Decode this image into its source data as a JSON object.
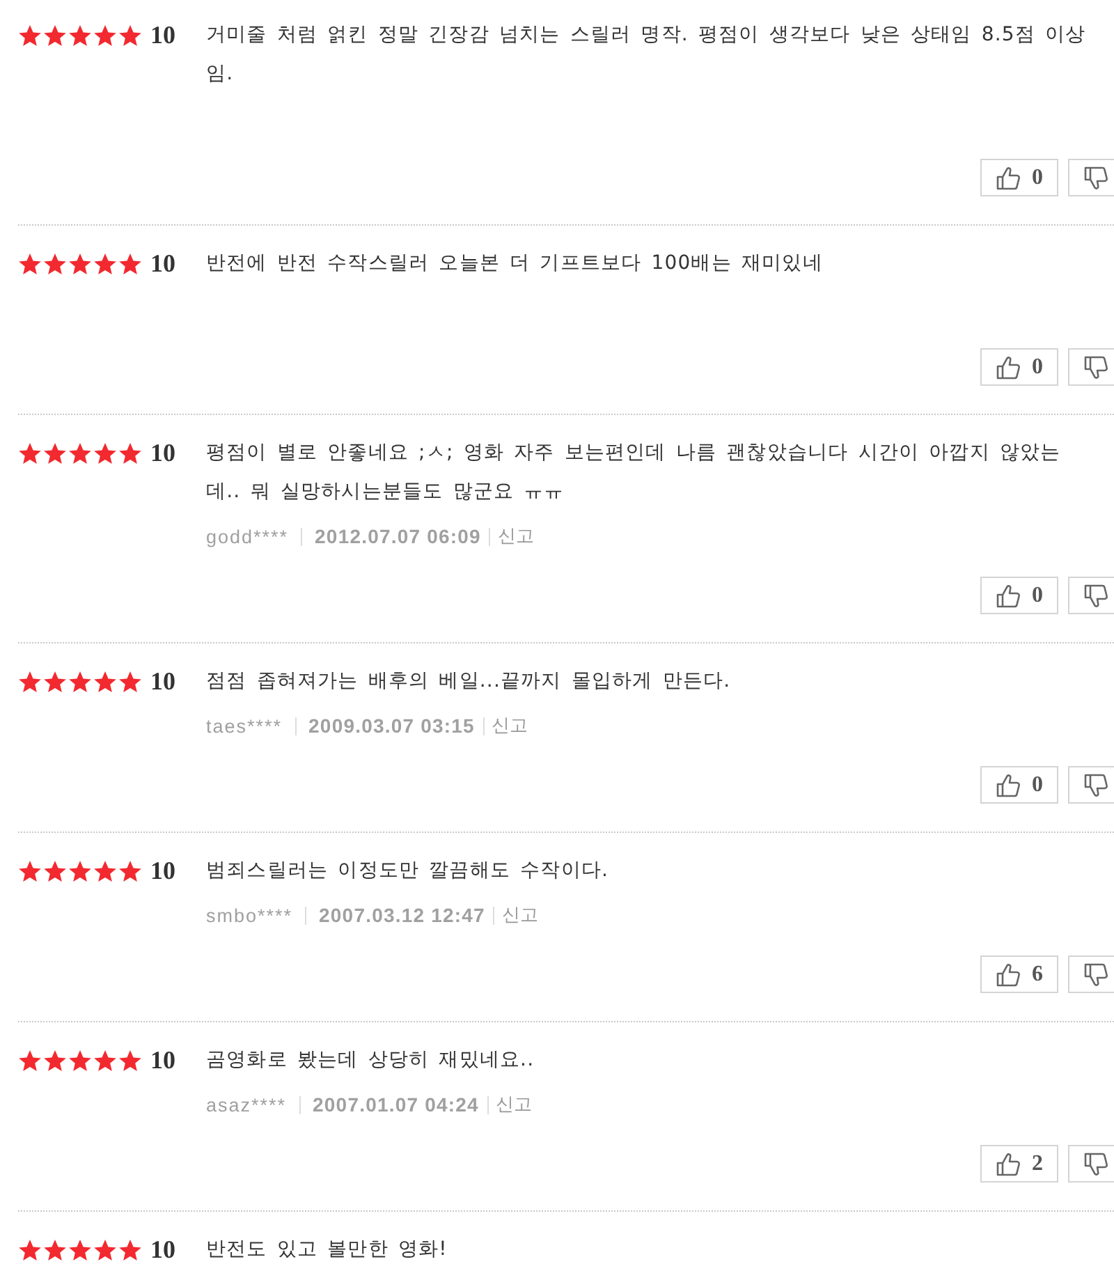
{
  "reviews": [
    {
      "stars": 5,
      "score": "10",
      "text": "거미줄 처럼 얽킨 정말 긴장감 넘치는 스릴러 명작. 평점이 생각보다 낮은 상태임 8.5점 이상임.",
      "likes": "0"
    },
    {
      "stars": 5,
      "score": "10",
      "text": "반전에 반전 수작스릴러 오늘본 더 기프트보다 100배는 재미있네",
      "likes": "0"
    },
    {
      "stars": 5,
      "score": "10",
      "text": "평점이 별로 안좋네요 ;ㅅ; 영화 자주 보는편인데 나름 괜찮았습니다 시간이 아깝지 않았는데.. 뭐 실망하시는분들도 많군요 ㅠㅠ",
      "author": "godd****",
      "date": "2012.07.07 06:09",
      "report": "신고",
      "likes": "0"
    },
    {
      "stars": 5,
      "score": "10",
      "text": "점점 좁혀져가는 배후의 베일...끝까지 몰입하게 만든다.",
      "author": "taes****",
      "date": "2009.03.07 03:15",
      "report": "신고",
      "likes": "0"
    },
    {
      "stars": 5,
      "score": "10",
      "text": "범죄스릴러는 이정도만 깔끔해도 수작이다.",
      "author": "smbo****",
      "date": "2007.03.12 12:47",
      "report": "신고",
      "likes": "6"
    },
    {
      "stars": 5,
      "score": "10",
      "text": "곰영화로 봤는데 상당히 재밌네요..",
      "author": "asaz****",
      "date": "2007.01.07 04:24",
      "report": "신고",
      "likes": "2"
    },
    {
      "stars": 5,
      "score": "10",
      "text": "반전도 있고 볼만한 영화!"
    }
  ]
}
